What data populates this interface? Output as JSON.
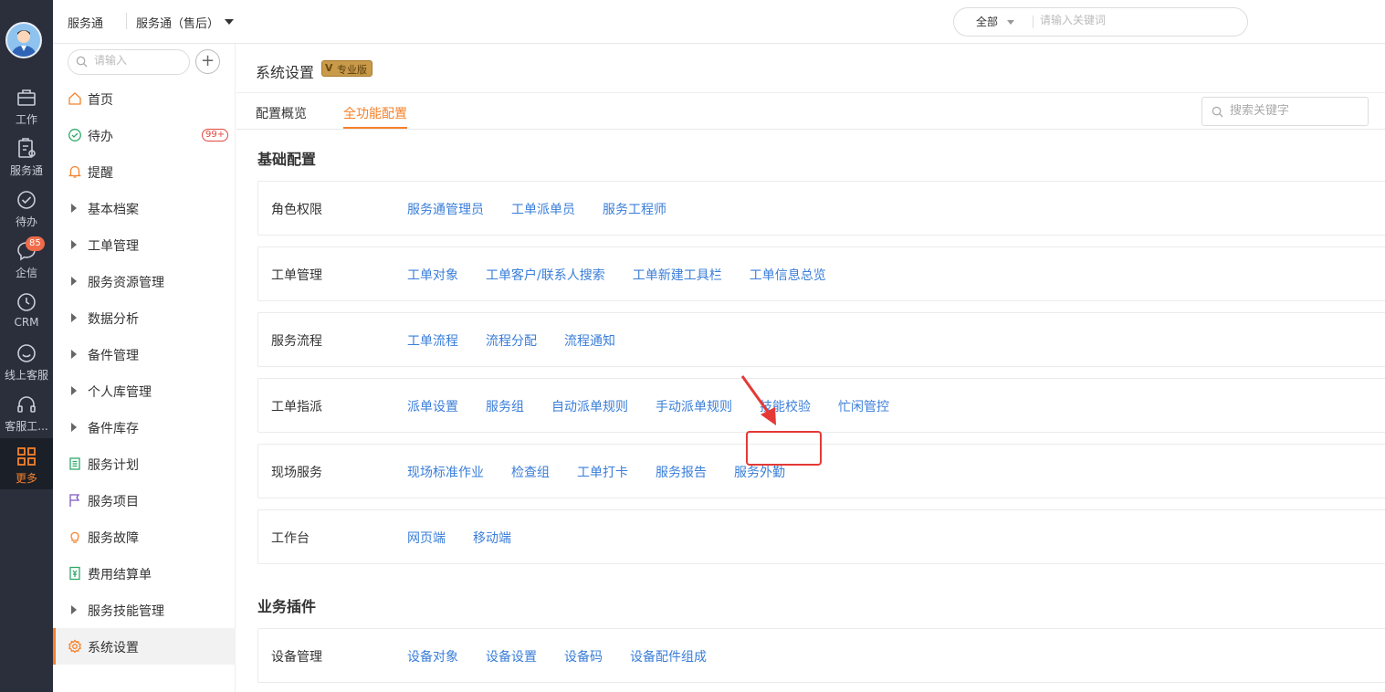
{
  "rail": {
    "items": [
      {
        "label": "工作",
        "icon": "briefcase-icon"
      },
      {
        "label": "服务通",
        "icon": "service-icon"
      },
      {
        "label": "待办",
        "icon": "check-circle-icon"
      },
      {
        "label": "企信",
        "icon": "chat-icon",
        "badge": "85"
      },
      {
        "label": "CRM",
        "icon": "clock-icon"
      },
      {
        "label": "线上客服",
        "icon": "smile-chat-icon"
      },
      {
        "label": "客服工...",
        "icon": "headset-icon"
      },
      {
        "label": "更多",
        "icon": "grid-icon",
        "active": true
      }
    ]
  },
  "topbar": {
    "app": "服务通",
    "module": "服务通（售后）",
    "search": {
      "scope": "全部",
      "placeholder": "请输入关键词"
    }
  },
  "sidebar": {
    "search_placeholder": "请输入",
    "items": [
      {
        "label": "首页",
        "icon": "home-icon"
      },
      {
        "label": "待办",
        "icon": "check-circle-icon",
        "badge": "99+"
      },
      {
        "label": "提醒",
        "icon": "bell-icon"
      },
      {
        "label": "基本档案",
        "icon": "expand-triangle-icon"
      },
      {
        "label": "工单管理",
        "icon": "expand-triangle-icon"
      },
      {
        "label": "服务资源管理",
        "icon": "expand-triangle-icon"
      },
      {
        "label": "数据分析",
        "icon": "expand-triangle-icon"
      },
      {
        "label": "备件管理",
        "icon": "expand-triangle-icon"
      },
      {
        "label": "个人库管理",
        "icon": "expand-triangle-icon"
      },
      {
        "label": "备件库存",
        "icon": "expand-triangle-icon"
      },
      {
        "label": "服务计划",
        "icon": "plan-icon"
      },
      {
        "label": "服务项目",
        "icon": "flag-icon"
      },
      {
        "label": "服务故障",
        "icon": "bulb-icon"
      },
      {
        "label": "费用结算单",
        "icon": "yen-doc-icon"
      },
      {
        "label": "服务技能管理",
        "icon": "expand-triangle-icon"
      },
      {
        "label": "系统设置",
        "icon": "gear-icon",
        "active": true
      }
    ]
  },
  "page": {
    "title": "系统设置",
    "badge": "专业版",
    "badge_mark": "V",
    "tabs": [
      "配置概览",
      "全功能配置"
    ],
    "active_tab": 1,
    "keyword_placeholder": "搜索关键字"
  },
  "sections": [
    {
      "title": "基础配置",
      "cards": [
        {
          "label": "角色权限",
          "links": [
            "服务通管理员",
            "工单派单员",
            "服务工程师"
          ]
        },
        {
          "label": "工单管理",
          "links": [
            "工单对象",
            "工单客户/联系人搜索",
            "工单新建工具栏",
            "工单信息总览"
          ]
        },
        {
          "label": "服务流程",
          "links": [
            "工单流程",
            "流程分配",
            "流程通知"
          ]
        },
        {
          "label": "工单指派",
          "links": [
            "派单设置",
            "服务组",
            "自动派单规则",
            "手动派单规则",
            "技能校验",
            "忙闲管控"
          ]
        },
        {
          "label": "现场服务",
          "links": [
            "现场标准作业",
            "检查组",
            "工单打卡",
            "服务报告",
            "服务外勤"
          ]
        },
        {
          "label": "工作台",
          "links": [
            "网页端",
            "移动端"
          ]
        }
      ]
    },
    {
      "title": "业务插件",
      "cards": [
        {
          "label": "设备管理",
          "links": [
            "设备对象",
            "设备设置",
            "设备码",
            "设备配件组成"
          ]
        }
      ]
    }
  ],
  "colors": {
    "accent": "#f5812a",
    "link": "#3a7ed8",
    "rail_bg": "#2a2f3b",
    "highlight": "#e53935"
  }
}
